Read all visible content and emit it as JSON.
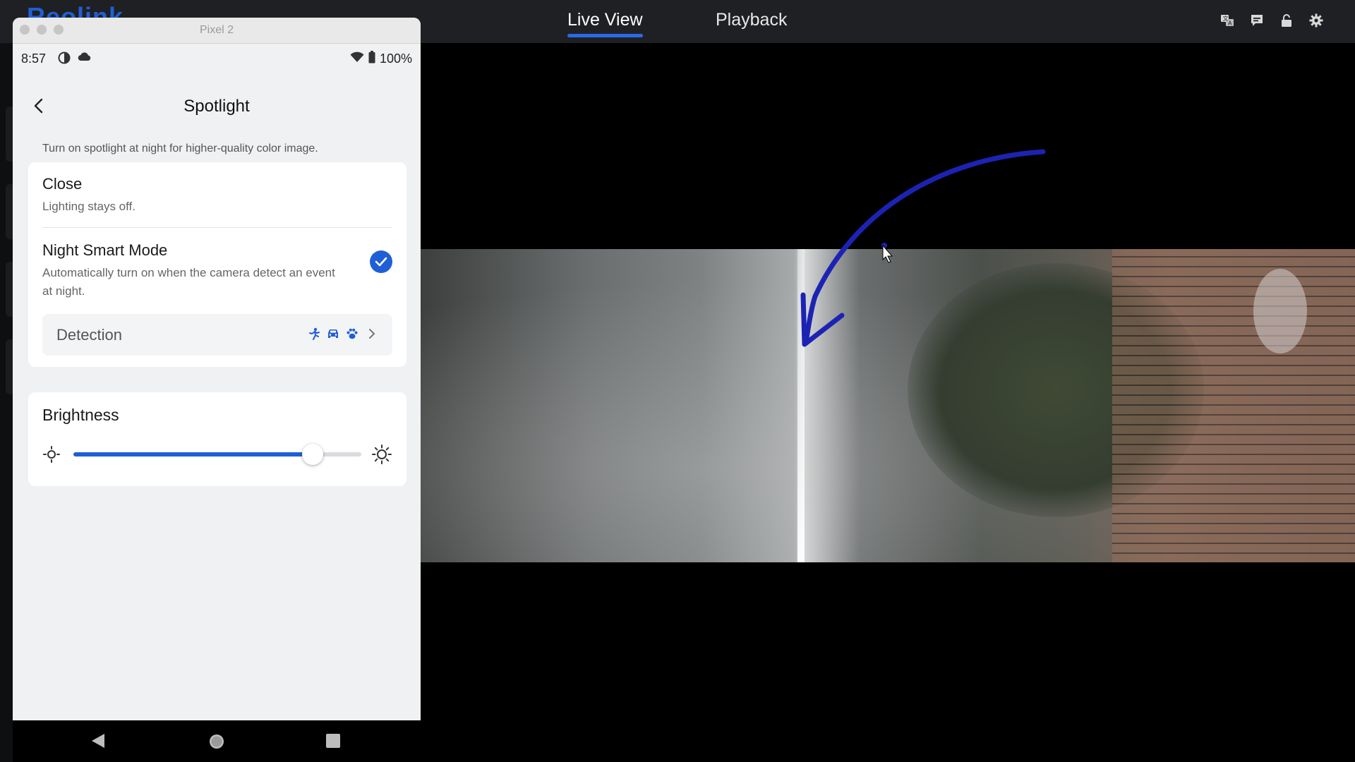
{
  "app": {
    "brand": "Reolink",
    "tabs": [
      {
        "label": "Live View",
        "active": true
      },
      {
        "label": "Playback",
        "active": false
      }
    ],
    "top_icons": [
      "translate-icon",
      "chat-icon",
      "lock-icon",
      "gear-icon"
    ],
    "accent": "#1f5fd6"
  },
  "emulator": {
    "title": "Pixel 2",
    "status": {
      "time": "8:57",
      "battery": "100%"
    },
    "screen": {
      "title": "Spotlight",
      "description": "Turn on spotlight at night for higher-quality color image.",
      "options": [
        {
          "title": "Close",
          "subtitle": "Lighting stays off.",
          "selected": false
        },
        {
          "title": "Night Smart Mode",
          "subtitle": "Automatically turn on when the camera detect an event at night.",
          "selected": true
        }
      ],
      "detection": {
        "label": "Detection",
        "icons": [
          "person-icon",
          "car-icon",
          "paw-icon"
        ]
      },
      "brightness": {
        "label": "Brightness",
        "value": 0.83
      }
    }
  }
}
